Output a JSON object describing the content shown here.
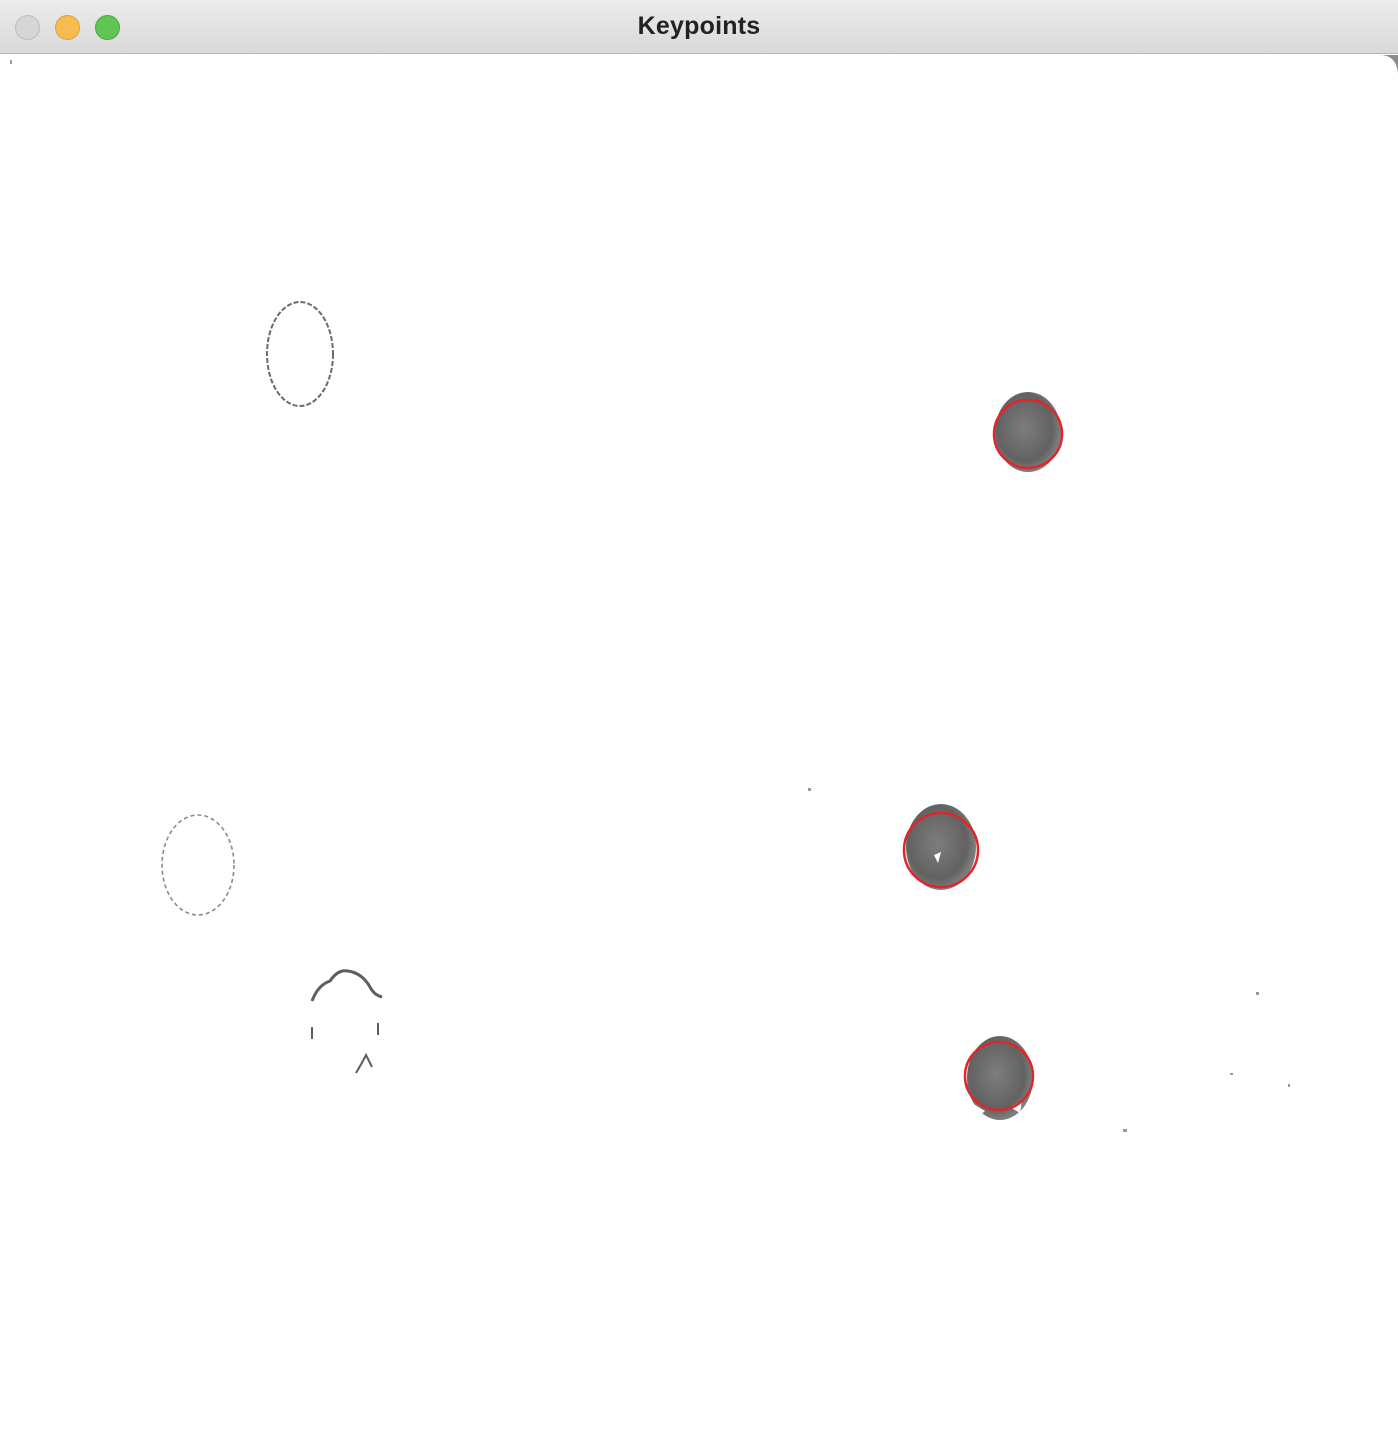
{
  "window": {
    "title": "Keypoints",
    "controls": [
      {
        "name": "close",
        "color": "#d6d6d6"
      },
      {
        "name": "minimize",
        "color": "#f5bd4f"
      },
      {
        "name": "zoom",
        "color": "#61c554"
      }
    ]
  },
  "image": {
    "description_colors": {
      "blob_fill": "#6a6a6a",
      "keypoint_circle": "#e0262a",
      "background": "#ffffff"
    },
    "keypoint_count": 3,
    "unmarked_blob_count": 3
  }
}
